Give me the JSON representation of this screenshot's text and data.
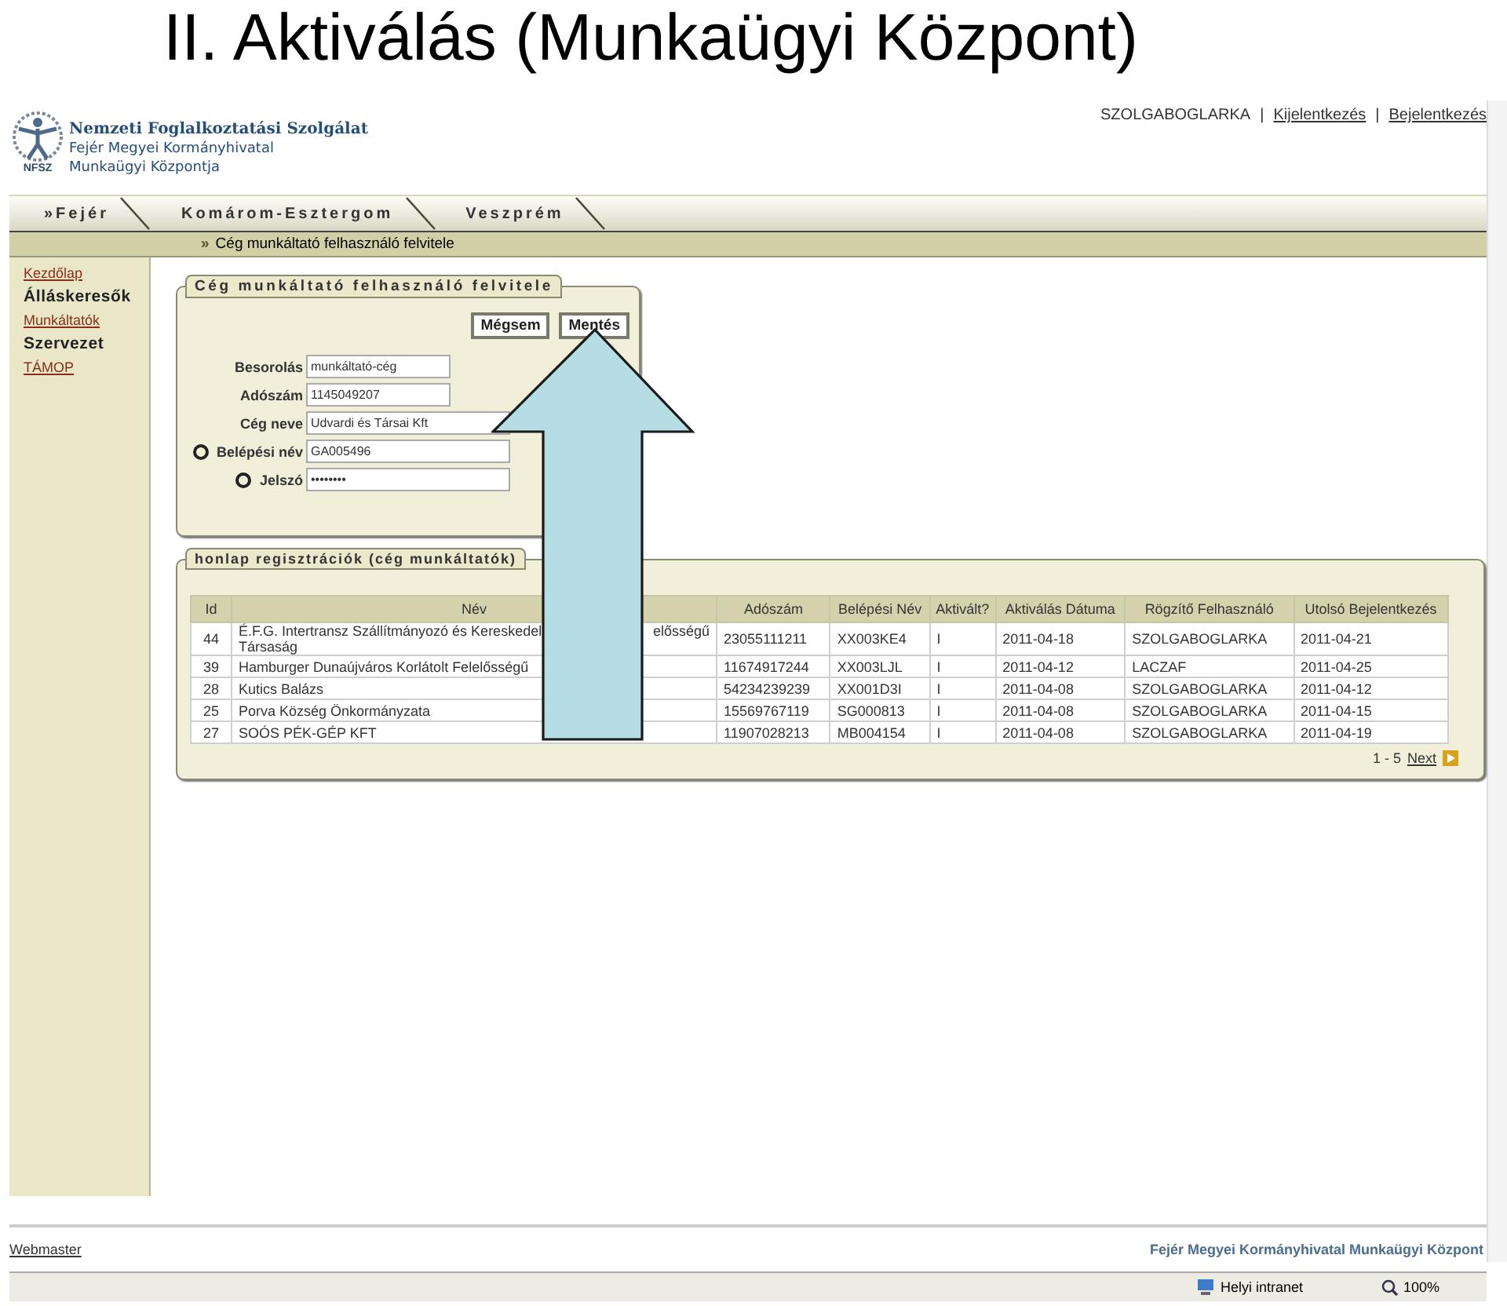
{
  "slide_title": "II. Aktiválás (Munkaügyi Központ)",
  "header": {
    "logo_caption": "NFSZ",
    "org_lines": [
      "Nemzeti Foglalkoztatási Szolgálat",
      "Fejér Megyei Kormányhivatal",
      "Munkaügyi Központja"
    ],
    "user": "SZOLGABOGLARKA",
    "separators": [
      "|",
      "|"
    ],
    "links": [
      "Kijelentkezés",
      "Bejelentkezés"
    ]
  },
  "tabs": [
    {
      "label": "»Fejér"
    },
    {
      "label": "Komárom-Esztergom"
    },
    {
      "label": "Veszprém"
    }
  ],
  "breadcrumb": {
    "mark": "»",
    "text": "Cég munkáltató felhasználó felvitele"
  },
  "sidebar": {
    "items": [
      {
        "label": "Kezdőlap",
        "kind": "link"
      },
      {
        "label": "Álláskeresők",
        "kind": "heading"
      },
      {
        "label": "Munkáltatók",
        "kind": "link"
      },
      {
        "label": "Szervezet",
        "kind": "heading"
      },
      {
        "label": "TÁMOP",
        "kind": "link"
      }
    ]
  },
  "form": {
    "title": "Cég munkáltató felhasználó felvitele",
    "buttons": [
      "Mégsem",
      "Mentés"
    ],
    "fields": [
      {
        "label": "Besorolás",
        "value": "munkáltató-cég",
        "marked": false,
        "wide": false
      },
      {
        "label": "Adószám",
        "value": "1145049207",
        "marked": false,
        "wide": false
      },
      {
        "label": "Cég neve",
        "value": "Udvardi és Társai Kft",
        "marked": false,
        "wide": true
      },
      {
        "label": "Belépési név",
        "value": "GA005496",
        "marked": true,
        "wide": true
      },
      {
        "label": "Jelszó",
        "value": "••••••••",
        "marked": true,
        "wide": true
      }
    ]
  },
  "table": {
    "title": "honlap regisztrációk (cég munkáltatók)",
    "columns": [
      "Id",
      "Név",
      "Adószám",
      "Belépési Név",
      "Aktivált?",
      "Aktiválás Dátuma",
      "Rögzítő Felhasználó",
      "Utolsó Bejelentkezés"
    ],
    "rows": [
      {
        "cells": [
          "44",
          [
            "É.F.G. Intertransz Szállítmányozó és Kereskedel",
            "elősségű",
            "Társaság"
          ],
          "23055111211",
          "XX003KE4",
          "I",
          "2011-04-18",
          "SZOLGABOGLARKA",
          "2011-04-21"
        ]
      },
      {
        "cells": [
          "39",
          [
            "Hamburger Dunaújváros Korlátolt Felelősségű"
          ],
          "11674917244",
          "XX003LJL",
          "I",
          "2011-04-12",
          "LACZAF",
          "2011-04-25"
        ]
      },
      {
        "cells": [
          "28",
          [
            "Kutics Balázs"
          ],
          "54234239239",
          "XX001D3I",
          "I",
          "2011-04-08",
          "SZOLGABOGLARKA",
          "2011-04-12"
        ]
      },
      {
        "cells": [
          "25",
          [
            "Porva Község Önkormányzata"
          ],
          "15569767119",
          "SG000813",
          "I",
          "2011-04-08",
          "SZOLGABOGLARKA",
          "2011-04-15"
        ]
      },
      {
        "cells": [
          "27",
          [
            "SOÓS PÉK-GÉP KFT"
          ],
          "11907028213",
          "MB004154",
          "I",
          "2011-04-08",
          "SZOLGABOGLARKA",
          "2011-04-19"
        ]
      }
    ],
    "pager": "1 - 5",
    "next": "Next"
  },
  "footer": {
    "left": "Webmaster",
    "right": "Fejér Megyei Kormányhivatal Munkaügyi Központ"
  },
  "status_bar": {
    "zone": "Helyi intranet",
    "zoom": "100%"
  }
}
